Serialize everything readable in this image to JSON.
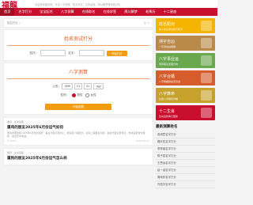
{
  "site": {
    "logo": "福龍",
    "top_note": "欢迎来到福龙网，专注八字命理、姓名测试、生肖运程、周公解梦等传统文化"
  },
  "nav": {
    "items": [
      "首页",
      "名字打分",
      "宝宝起名",
      "八字测算",
      "在线取名",
      "在线求签",
      "周公解梦",
      "老黄历",
      "十二星座"
    ]
  },
  "breadcrumb": {
    "text": "姓名打分 ›",
    "right": "◎ ☆"
  },
  "name_test": {
    "title": "姓名测试打分",
    "surname_label": "姓氏：",
    "name_label": "名字：",
    "button": "开始打分"
  },
  "bazi": {
    "title": "八字测算",
    "birth_label": "公历：",
    "year": "1990",
    "month": "01",
    "day": "01",
    "hour": "子时",
    "gender_label": "性别：",
    "gender_options": [
      "男性",
      "女性"
    ],
    "button": "开始测算"
  },
  "articles": [
    {
      "meta": "要闻 · 生肖运程",
      "title": "属鸡的朋友2025年6月份运气如何",
      "desc": "属鸡的朋友在2025年6月份的运势：事业方面平稳向上，财运有小幅起伏，感情上需要多沟通，健康方面注意休息，整体运势较为顺利，适合稳中求进。",
      "views": "© 2345",
      "date": "2025-06-01"
    },
    {
      "meta": "要闻 · 生肖运程",
      "title": "属狗的朋友2025年6月份运气怎么样",
      "desc": "",
      "views": "",
      "date": ""
    }
  ],
  "side_cards": [
    {
      "title": "姓名配对",
      "sub": "输入姓名测试缘分配对",
      "color": "#f5b400"
    },
    {
      "title": "测字吉凶",
      "sub": "一字测吉凶祸福",
      "color": "#b98a4a"
    },
    {
      "title": "八字事业运",
      "sub": "测算事业发展方向",
      "color": "#6aa84f"
    },
    {
      "title": "八字合婚",
      "sub": "八字看姻缘是否合适",
      "color": "#d65c2c"
    },
    {
      "title": "八字算命",
      "sub": "生辰八字精批详解",
      "color": "#c6a22d"
    },
    {
      "title": "十二生肖",
      "sub": "生肖运势每日更新",
      "color": "#c8102e"
    }
  ],
  "side_list": {
    "heading": "最新测算姓名",
    "items": [
      "张玥萱名字打分",
      "魏天佑名字打分",
      "李梓涵名字打分",
      "陈子墨名字打分",
      "王思远名字打分",
      "赵一诺名字打分",
      "周雨彤名字打分",
      "刘浩宇名字打分"
    ]
  }
}
